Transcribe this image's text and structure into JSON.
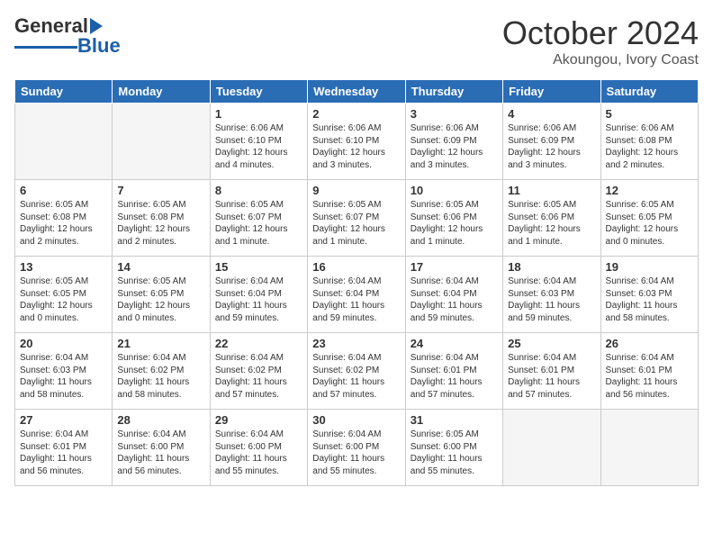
{
  "logo": {
    "text_general": "General",
    "text_blue": "Blue"
  },
  "title": "October 2024",
  "location": "Akoungou, Ivory Coast",
  "days_of_week": [
    "Sunday",
    "Monday",
    "Tuesday",
    "Wednesday",
    "Thursday",
    "Friday",
    "Saturday"
  ],
  "weeks": [
    [
      {
        "day": "",
        "content": ""
      },
      {
        "day": "",
        "content": ""
      },
      {
        "day": "1",
        "content": "Sunrise: 6:06 AM\nSunset: 6:10 PM\nDaylight: 12 hours and 4 minutes."
      },
      {
        "day": "2",
        "content": "Sunrise: 6:06 AM\nSunset: 6:10 PM\nDaylight: 12 hours and 3 minutes."
      },
      {
        "day": "3",
        "content": "Sunrise: 6:06 AM\nSunset: 6:09 PM\nDaylight: 12 hours and 3 minutes."
      },
      {
        "day": "4",
        "content": "Sunrise: 6:06 AM\nSunset: 6:09 PM\nDaylight: 12 hours and 3 minutes."
      },
      {
        "day": "5",
        "content": "Sunrise: 6:06 AM\nSunset: 6:08 PM\nDaylight: 12 hours and 2 minutes."
      }
    ],
    [
      {
        "day": "6",
        "content": "Sunrise: 6:05 AM\nSunset: 6:08 PM\nDaylight: 12 hours and 2 minutes."
      },
      {
        "day": "7",
        "content": "Sunrise: 6:05 AM\nSunset: 6:08 PM\nDaylight: 12 hours and 2 minutes."
      },
      {
        "day": "8",
        "content": "Sunrise: 6:05 AM\nSunset: 6:07 PM\nDaylight: 12 hours and 1 minute."
      },
      {
        "day": "9",
        "content": "Sunrise: 6:05 AM\nSunset: 6:07 PM\nDaylight: 12 hours and 1 minute."
      },
      {
        "day": "10",
        "content": "Sunrise: 6:05 AM\nSunset: 6:06 PM\nDaylight: 12 hours and 1 minute."
      },
      {
        "day": "11",
        "content": "Sunrise: 6:05 AM\nSunset: 6:06 PM\nDaylight: 12 hours and 1 minute."
      },
      {
        "day": "12",
        "content": "Sunrise: 6:05 AM\nSunset: 6:05 PM\nDaylight: 12 hours and 0 minutes."
      }
    ],
    [
      {
        "day": "13",
        "content": "Sunrise: 6:05 AM\nSunset: 6:05 PM\nDaylight: 12 hours and 0 minutes."
      },
      {
        "day": "14",
        "content": "Sunrise: 6:05 AM\nSunset: 6:05 PM\nDaylight: 12 hours and 0 minutes."
      },
      {
        "day": "15",
        "content": "Sunrise: 6:04 AM\nSunset: 6:04 PM\nDaylight: 11 hours and 59 minutes."
      },
      {
        "day": "16",
        "content": "Sunrise: 6:04 AM\nSunset: 6:04 PM\nDaylight: 11 hours and 59 minutes."
      },
      {
        "day": "17",
        "content": "Sunrise: 6:04 AM\nSunset: 6:04 PM\nDaylight: 11 hours and 59 minutes."
      },
      {
        "day": "18",
        "content": "Sunrise: 6:04 AM\nSunset: 6:03 PM\nDaylight: 11 hours and 59 minutes."
      },
      {
        "day": "19",
        "content": "Sunrise: 6:04 AM\nSunset: 6:03 PM\nDaylight: 11 hours and 58 minutes."
      }
    ],
    [
      {
        "day": "20",
        "content": "Sunrise: 6:04 AM\nSunset: 6:03 PM\nDaylight: 11 hours and 58 minutes."
      },
      {
        "day": "21",
        "content": "Sunrise: 6:04 AM\nSunset: 6:02 PM\nDaylight: 11 hours and 58 minutes."
      },
      {
        "day": "22",
        "content": "Sunrise: 6:04 AM\nSunset: 6:02 PM\nDaylight: 11 hours and 57 minutes."
      },
      {
        "day": "23",
        "content": "Sunrise: 6:04 AM\nSunset: 6:02 PM\nDaylight: 11 hours and 57 minutes."
      },
      {
        "day": "24",
        "content": "Sunrise: 6:04 AM\nSunset: 6:01 PM\nDaylight: 11 hours and 57 minutes."
      },
      {
        "day": "25",
        "content": "Sunrise: 6:04 AM\nSunset: 6:01 PM\nDaylight: 11 hours and 57 minutes."
      },
      {
        "day": "26",
        "content": "Sunrise: 6:04 AM\nSunset: 6:01 PM\nDaylight: 11 hours and 56 minutes."
      }
    ],
    [
      {
        "day": "27",
        "content": "Sunrise: 6:04 AM\nSunset: 6:01 PM\nDaylight: 11 hours and 56 minutes."
      },
      {
        "day": "28",
        "content": "Sunrise: 6:04 AM\nSunset: 6:00 PM\nDaylight: 11 hours and 56 minutes."
      },
      {
        "day": "29",
        "content": "Sunrise: 6:04 AM\nSunset: 6:00 PM\nDaylight: 11 hours and 55 minutes."
      },
      {
        "day": "30",
        "content": "Sunrise: 6:04 AM\nSunset: 6:00 PM\nDaylight: 11 hours and 55 minutes."
      },
      {
        "day": "31",
        "content": "Sunrise: 6:05 AM\nSunset: 6:00 PM\nDaylight: 11 hours and 55 minutes."
      },
      {
        "day": "",
        "content": ""
      },
      {
        "day": "",
        "content": ""
      }
    ]
  ]
}
